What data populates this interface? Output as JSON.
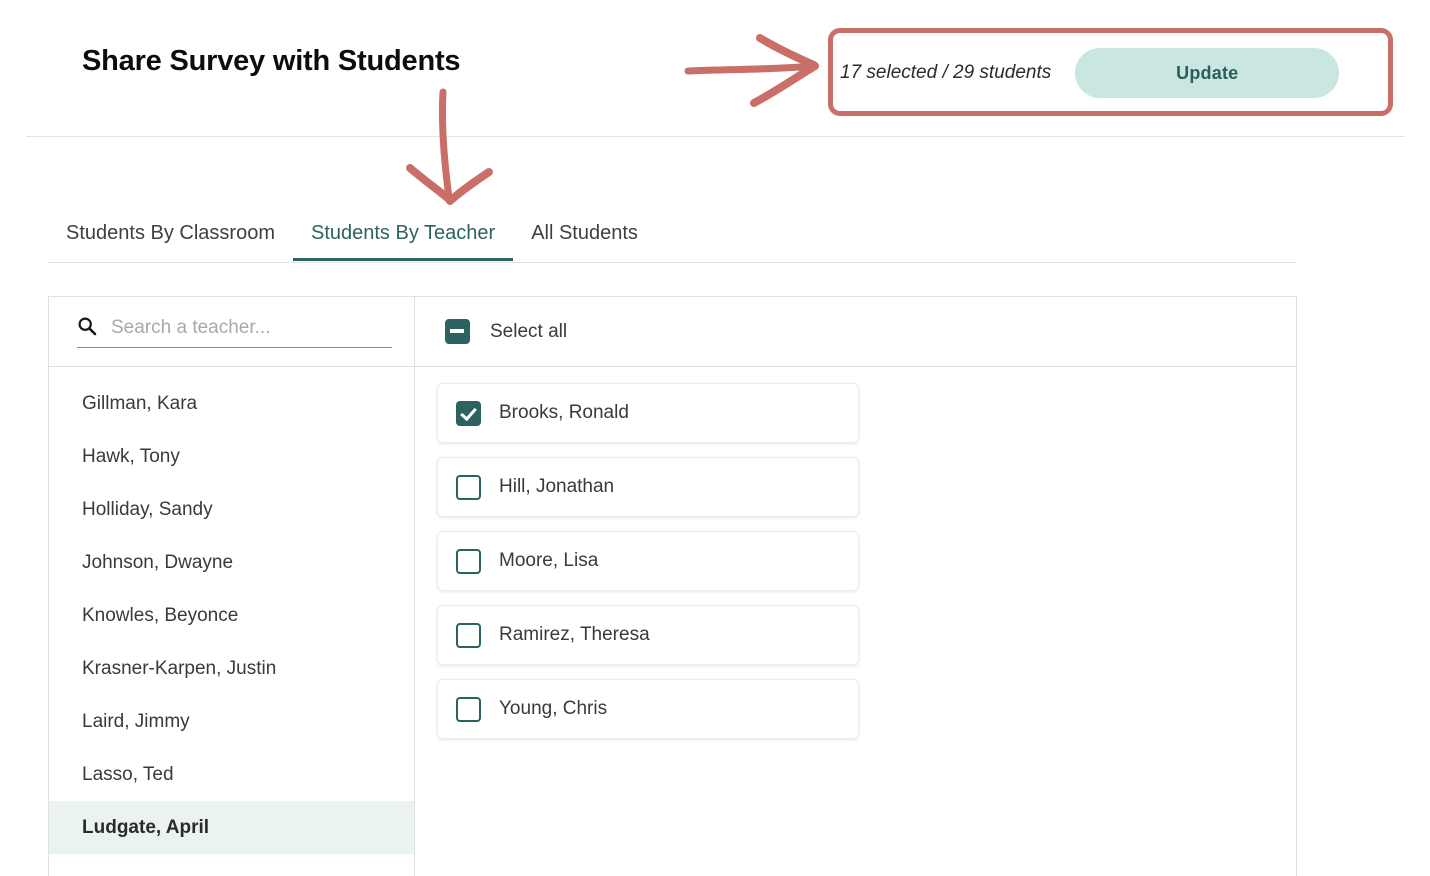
{
  "header": {
    "title": "Share Survey with Students",
    "selection_count": "17 selected / 29 students",
    "update_label": "Update"
  },
  "tabs": [
    {
      "label": "Students By Classroom",
      "active": false
    },
    {
      "label": "Students By Teacher",
      "active": true
    },
    {
      "label": "All Students",
      "active": false
    }
  ],
  "search": {
    "placeholder": "Search a teacher...",
    "value": "",
    "icon": "search-icon"
  },
  "select_all": {
    "label": "Select all",
    "state": "indeterminate"
  },
  "teachers": [
    {
      "name": "Gillman, Kara",
      "selected": false
    },
    {
      "name": "Hawk, Tony",
      "selected": false
    },
    {
      "name": "Holliday, Sandy",
      "selected": false
    },
    {
      "name": "Johnson, Dwayne",
      "selected": false
    },
    {
      "name": "Knowles, Beyonce",
      "selected": false
    },
    {
      "name": "Krasner-Karpen, Justin",
      "selected": false
    },
    {
      "name": "Laird, Jimmy",
      "selected": false
    },
    {
      "name": "Lasso, Ted",
      "selected": false
    },
    {
      "name": "Ludgate, April",
      "selected": true
    }
  ],
  "students": [
    {
      "name": "Brooks, Ronald",
      "checked": true
    },
    {
      "name": "Hill, Jonathan",
      "checked": false
    },
    {
      "name": "Moore, Lisa",
      "checked": false
    },
    {
      "name": "Ramirez, Theresa",
      "checked": false
    },
    {
      "name": "Young, Chris",
      "checked": false
    }
  ],
  "annotations": {
    "arrow_right": "arrow-right-annotation",
    "arrow_down": "arrow-down-annotation",
    "highlight_box": "selection-controls-highlight-box",
    "color": "#ca6f68"
  },
  "colors": {
    "accent_teal": "#2c6360",
    "button_bg": "#c9e6e1",
    "selected_row_bg": "#eaf3ef",
    "annotation_red": "#ca6f68"
  }
}
